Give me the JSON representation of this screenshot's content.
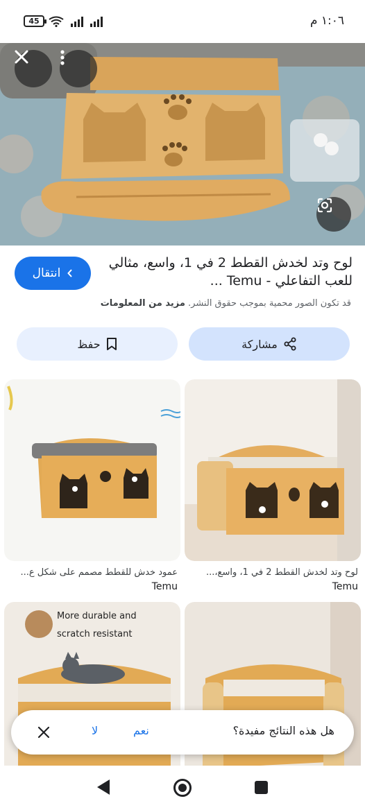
{
  "status_bar": {
    "battery": "45",
    "time": "١:٠٦ م"
  },
  "hero": {
    "close_icon": "close-icon",
    "more_icon": "more-vert-icon",
    "lens_icon": "google-lens-icon"
  },
  "result": {
    "title": "لوح وتد لخدش القطط 2 في 1، واسع، مثالي للعب التفاعلي - Temu ...",
    "copyright_text": "قد تكون الصور محمية بموجب حقوق النشر.",
    "learn_more": "مزيد من المعلومات",
    "visit_label": "انتقال",
    "share_label": "مشاركة",
    "save_label": "حفظ"
  },
  "grid": [
    {
      "title": "لوح وتد لخدش القطط 2 في 1، واسع،...",
      "source": "Temu"
    },
    {
      "title": "عمود خدش للقطط مصمم على شكل ع...",
      "source": "Temu"
    },
    {
      "title": "",
      "source": ""
    },
    {
      "title": "",
      "source": ""
    }
  ],
  "grid_image_text": {
    "line1": "More durable and",
    "line2": "scratch resistant"
  },
  "feedback": {
    "question": "هل هذه النتائج مفيدة؟",
    "yes": "نعم",
    "no": "لا"
  },
  "colors": {
    "accent": "#1a73e8",
    "share_bg": "#d3e3fd",
    "save_bg": "#e8f0fe",
    "wood": "#d9a45a"
  }
}
